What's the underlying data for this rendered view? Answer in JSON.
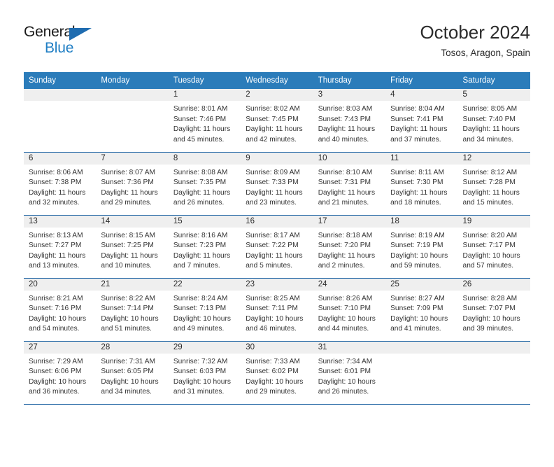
{
  "brand": {
    "name_top": "General",
    "name_bottom": "Blue",
    "triangle_color": "#1f6cb0",
    "blue_text_color": "#1f7ec4"
  },
  "header": {
    "title": "October 2024",
    "location": "Tosos, Aragon, Spain"
  },
  "calendar": {
    "header_bg": "#2b7cba",
    "row_divider_color": "#2b6ca8",
    "daynum_bg": "#efefef",
    "weekdays": [
      "Sunday",
      "Monday",
      "Tuesday",
      "Wednesday",
      "Thursday",
      "Friday",
      "Saturday"
    ],
    "weeks": [
      [
        {
          "day": "",
          "lines": []
        },
        {
          "day": "",
          "lines": []
        },
        {
          "day": "1",
          "lines": [
            "Sunrise: 8:01 AM",
            "Sunset: 7:46 PM",
            "Daylight: 11 hours",
            "and 45 minutes."
          ]
        },
        {
          "day": "2",
          "lines": [
            "Sunrise: 8:02 AM",
            "Sunset: 7:45 PM",
            "Daylight: 11 hours",
            "and 42 minutes."
          ]
        },
        {
          "day": "3",
          "lines": [
            "Sunrise: 8:03 AM",
            "Sunset: 7:43 PM",
            "Daylight: 11 hours",
            "and 40 minutes."
          ]
        },
        {
          "day": "4",
          "lines": [
            "Sunrise: 8:04 AM",
            "Sunset: 7:41 PM",
            "Daylight: 11 hours",
            "and 37 minutes."
          ]
        },
        {
          "day": "5",
          "lines": [
            "Sunrise: 8:05 AM",
            "Sunset: 7:40 PM",
            "Daylight: 11 hours",
            "and 34 minutes."
          ]
        }
      ],
      [
        {
          "day": "6",
          "lines": [
            "Sunrise: 8:06 AM",
            "Sunset: 7:38 PM",
            "Daylight: 11 hours",
            "and 32 minutes."
          ]
        },
        {
          "day": "7",
          "lines": [
            "Sunrise: 8:07 AM",
            "Sunset: 7:36 PM",
            "Daylight: 11 hours",
            "and 29 minutes."
          ]
        },
        {
          "day": "8",
          "lines": [
            "Sunrise: 8:08 AM",
            "Sunset: 7:35 PM",
            "Daylight: 11 hours",
            "and 26 minutes."
          ]
        },
        {
          "day": "9",
          "lines": [
            "Sunrise: 8:09 AM",
            "Sunset: 7:33 PM",
            "Daylight: 11 hours",
            "and 23 minutes."
          ]
        },
        {
          "day": "10",
          "lines": [
            "Sunrise: 8:10 AM",
            "Sunset: 7:31 PM",
            "Daylight: 11 hours",
            "and 21 minutes."
          ]
        },
        {
          "day": "11",
          "lines": [
            "Sunrise: 8:11 AM",
            "Sunset: 7:30 PM",
            "Daylight: 11 hours",
            "and 18 minutes."
          ]
        },
        {
          "day": "12",
          "lines": [
            "Sunrise: 8:12 AM",
            "Sunset: 7:28 PM",
            "Daylight: 11 hours",
            "and 15 minutes."
          ]
        }
      ],
      [
        {
          "day": "13",
          "lines": [
            "Sunrise: 8:13 AM",
            "Sunset: 7:27 PM",
            "Daylight: 11 hours",
            "and 13 minutes."
          ]
        },
        {
          "day": "14",
          "lines": [
            "Sunrise: 8:15 AM",
            "Sunset: 7:25 PM",
            "Daylight: 11 hours",
            "and 10 minutes."
          ]
        },
        {
          "day": "15",
          "lines": [
            "Sunrise: 8:16 AM",
            "Sunset: 7:23 PM",
            "Daylight: 11 hours",
            "and 7 minutes."
          ]
        },
        {
          "day": "16",
          "lines": [
            "Sunrise: 8:17 AM",
            "Sunset: 7:22 PM",
            "Daylight: 11 hours",
            "and 5 minutes."
          ]
        },
        {
          "day": "17",
          "lines": [
            "Sunrise: 8:18 AM",
            "Sunset: 7:20 PM",
            "Daylight: 11 hours",
            "and 2 minutes."
          ]
        },
        {
          "day": "18",
          "lines": [
            "Sunrise: 8:19 AM",
            "Sunset: 7:19 PM",
            "Daylight: 10 hours",
            "and 59 minutes."
          ]
        },
        {
          "day": "19",
          "lines": [
            "Sunrise: 8:20 AM",
            "Sunset: 7:17 PM",
            "Daylight: 10 hours",
            "and 57 minutes."
          ]
        }
      ],
      [
        {
          "day": "20",
          "lines": [
            "Sunrise: 8:21 AM",
            "Sunset: 7:16 PM",
            "Daylight: 10 hours",
            "and 54 minutes."
          ]
        },
        {
          "day": "21",
          "lines": [
            "Sunrise: 8:22 AM",
            "Sunset: 7:14 PM",
            "Daylight: 10 hours",
            "and 51 minutes."
          ]
        },
        {
          "day": "22",
          "lines": [
            "Sunrise: 8:24 AM",
            "Sunset: 7:13 PM",
            "Daylight: 10 hours",
            "and 49 minutes."
          ]
        },
        {
          "day": "23",
          "lines": [
            "Sunrise: 8:25 AM",
            "Sunset: 7:11 PM",
            "Daylight: 10 hours",
            "and 46 minutes."
          ]
        },
        {
          "day": "24",
          "lines": [
            "Sunrise: 8:26 AM",
            "Sunset: 7:10 PM",
            "Daylight: 10 hours",
            "and 44 minutes."
          ]
        },
        {
          "day": "25",
          "lines": [
            "Sunrise: 8:27 AM",
            "Sunset: 7:09 PM",
            "Daylight: 10 hours",
            "and 41 minutes."
          ]
        },
        {
          "day": "26",
          "lines": [
            "Sunrise: 8:28 AM",
            "Sunset: 7:07 PM",
            "Daylight: 10 hours",
            "and 39 minutes."
          ]
        }
      ],
      [
        {
          "day": "27",
          "lines": [
            "Sunrise: 7:29 AM",
            "Sunset: 6:06 PM",
            "Daylight: 10 hours",
            "and 36 minutes."
          ]
        },
        {
          "day": "28",
          "lines": [
            "Sunrise: 7:31 AM",
            "Sunset: 6:05 PM",
            "Daylight: 10 hours",
            "and 34 minutes."
          ]
        },
        {
          "day": "29",
          "lines": [
            "Sunrise: 7:32 AM",
            "Sunset: 6:03 PM",
            "Daylight: 10 hours",
            "and 31 minutes."
          ]
        },
        {
          "day": "30",
          "lines": [
            "Sunrise: 7:33 AM",
            "Sunset: 6:02 PM",
            "Daylight: 10 hours",
            "and 29 minutes."
          ]
        },
        {
          "day": "31",
          "lines": [
            "Sunrise: 7:34 AM",
            "Sunset: 6:01 PM",
            "Daylight: 10 hours",
            "and 26 minutes."
          ]
        },
        {
          "day": "",
          "lines": []
        },
        {
          "day": "",
          "lines": []
        }
      ]
    ]
  }
}
